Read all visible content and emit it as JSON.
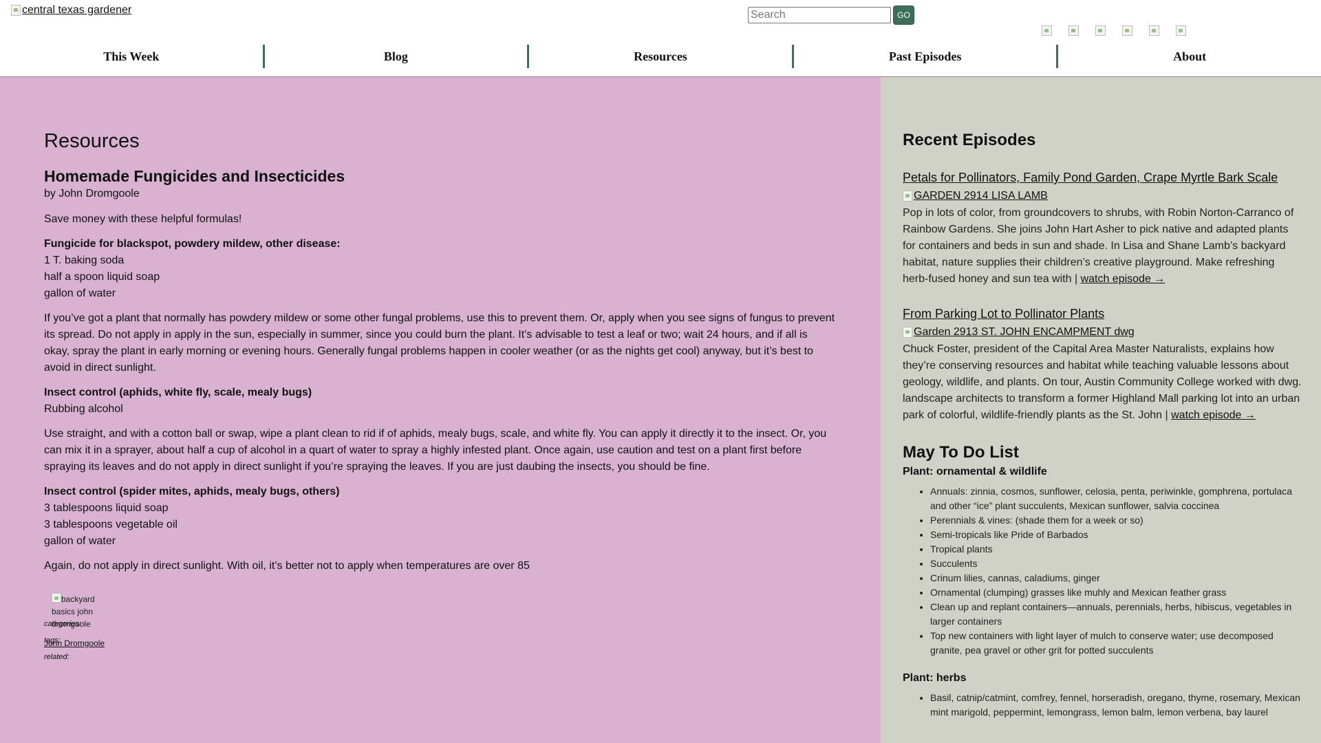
{
  "header": {
    "logo_alt": "central texas gardener",
    "search_placeholder": "Search",
    "go_label": "GO",
    "nav": [
      "This Week",
      "Blog",
      "Resources",
      "Past Episodes",
      "About"
    ]
  },
  "main": {
    "page_title": "Resources",
    "post_title": "Homemade Fungicides and Insecticides",
    "byline": "by John Dromgoole",
    "intro": "Save money with these helpful formulas!",
    "fungicide_heading": "Fungicide for blackspot, powdery mildew, other disease:",
    "fungicide_items": [
      "1 T. baking soda",
      "half a spoon liquid soap",
      "gallon of water"
    ],
    "fungicide_text": "If you’ve got a plant that normally has powdery mildew or some other fungal problems, use this to prevent them. Or, apply when you see signs of fungus to prevent its spread.  Do not apply in apply in the sun, especially in summer, since you could burn the plant.  It’s advisable to test a leaf or two; wait 24 hours, and if all is okay, spray the plant in early morning or evening hours. Generally fungal problems happen in cooler weather (or as the nights get cool) anyway, but it’s best to avoid in direct sunlight.",
    "insect1_heading": "Insect control (aphids, white fly, scale, mealy bugs)",
    "insect1_items": [
      "Rubbing alcohol"
    ],
    "insect1_text": "Use straight, and with a cotton ball or swap, wipe a plant clean to rid if of aphids, mealy bugs, scale, and white fly.  You can apply it directly it to the insect.  Or, you can mix it in a sprayer, about half a cup of alcohol in a quart of water to spray a highly infested plant.  Once again, use caution and test on a plant first before spraying its leaves and do not apply in direct sunlight if you’re spraying the leaves.  If you are just daubing the insects, you should be fine.",
    "insect2_heading": "Insect control (spider mites, aphids, mealy bugs, others)",
    "insect2_items": [
      "3 tablespoons liquid soap",
      "3 tablespoons vegetable oil",
      "gallon of water"
    ],
    "insect2_text": "Again, do not apply in direct sunlight.  With oil, it’s better not to apply when temperatures are over 85",
    "meta": {
      "categories": "categories:",
      "tags": "tags:",
      "related": "related:"
    },
    "related_card_alt": "backyard basics john dromgoole",
    "related_link": "John Dromgoole"
  },
  "sidebar": {
    "recent_heading": "Recent Episodes",
    "episodes": [
      {
        "title": "Petals for Pollinators, Family Pond Garden, Crape Myrtle Bark Scale",
        "image_alt": "GARDEN 2914 LISA LAMB",
        "desc": "Pop in lots of color, from groundcovers to shrubs, with Robin Norton-Carranco of Rainbow Gardens. She joins John Hart Asher to pick native and adapted plants for containers and beds in sun and shade. In Lisa and Shane Lamb’s backyard habitat, nature supplies their children’s creative playground. Make refreshing herb-fused honey and sun tea with |",
        "link": "watch episode →"
      },
      {
        "title": "From Parking Lot to Pollinator Plants",
        "image_alt": "Garden 2913 ST. JOHN ENCAMPMENT dwg",
        "desc": "Chuck Foster, president of the Capital Area Master Naturalists, explains how they’re conserving resources and habitat while teaching valuable lessons about geology, wildlife, and plants. On tour, Austin Community College worked with dwg. landscape architects to transform a former Highland Mall parking lot into an urban park of colorful, wildlife-friendly plants as the St. John |",
        "link": "watch episode →"
      }
    ],
    "todo_heading": "May To Do List",
    "todo_sections": [
      {
        "heading": "Plant: ornamental & wildlife",
        "items": [
          "Annuals:  zinnia, cosmos, sunflower, celosia, penta, periwinkle, gomphrena, portulaca and other “ice” plant succulents, Mexican sunflower, salvia coccinea",
          "Perennials & vines:  (shade them for a week or so)",
          "Semi-tropicals like Pride of Barbados",
          "Tropical plants",
          "Succulents",
          "Crinum lilies, cannas, caladiums, ginger",
          "Ornamental (clumping) grasses like muhly and Mexican feather grass",
          "Clean up and replant containers—annuals, perennials, herbs, hibiscus, vegetables in larger containers",
          "Top new containers with light layer of mulch to conserve water; use decomposed granite, pea gravel or other grit for potted succulents"
        ]
      },
      {
        "heading": "Plant: herbs",
        "items": [
          "Basil, catnip/catmint, comfrey, fennel, horseradish, oregano, thyme, rosemary, Mexican mint marigold, peppermint, lemongrass, lemon balm, lemon verbena, bay laurel"
        ]
      }
    ]
  },
  "colors": {
    "main_bg": "#d9b1d1",
    "sidebar_bg": "#d0d2c7",
    "accent": "#3f6d5c"
  }
}
